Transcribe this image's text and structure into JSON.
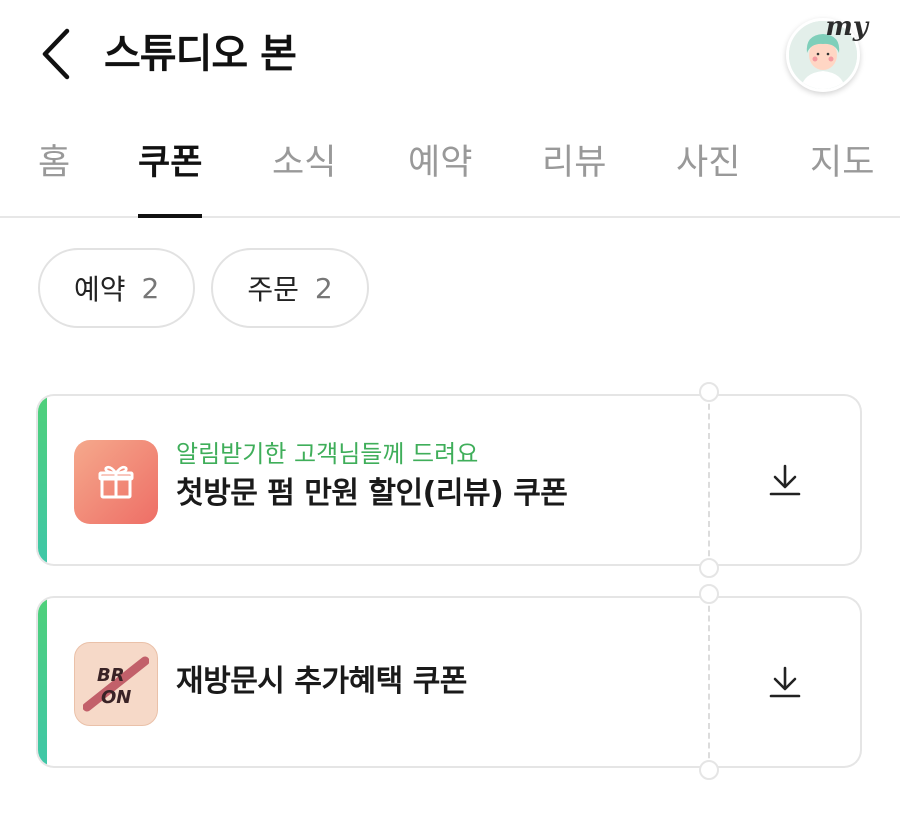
{
  "header": {
    "title": "스튜디오 본",
    "my_label": "my",
    "back_icon": "chevron-left-icon"
  },
  "tabs": [
    {
      "label": "홈",
      "active": false
    },
    {
      "label": "쿠폰",
      "active": true
    },
    {
      "label": "소식",
      "active": false
    },
    {
      "label": "예약",
      "active": false
    },
    {
      "label": "리뷰",
      "active": false
    },
    {
      "label": "사진",
      "active": false
    },
    {
      "label": "지도",
      "active": false
    }
  ],
  "filters": [
    {
      "label": "예약",
      "count": "2"
    },
    {
      "label": "주문",
      "count": "2"
    }
  ],
  "coupons": [
    {
      "subtitle": "알림받기한 고객님들께 드려요",
      "title": "첫방문 펌 만원 할인(리뷰) 쿠폰",
      "icon": "gift-icon",
      "action_icon": "download-icon"
    },
    {
      "subtitle": "",
      "title": "재방문시 추가혜택 쿠폰",
      "icon": "brand-logo-icon",
      "logo_text_top": "BR",
      "logo_text_bottom": "ON",
      "action_icon": "download-icon"
    }
  ],
  "colors": {
    "accent_green": "#3fae5a",
    "tab_active": "#111111",
    "tab_inactive": "#999999"
  }
}
